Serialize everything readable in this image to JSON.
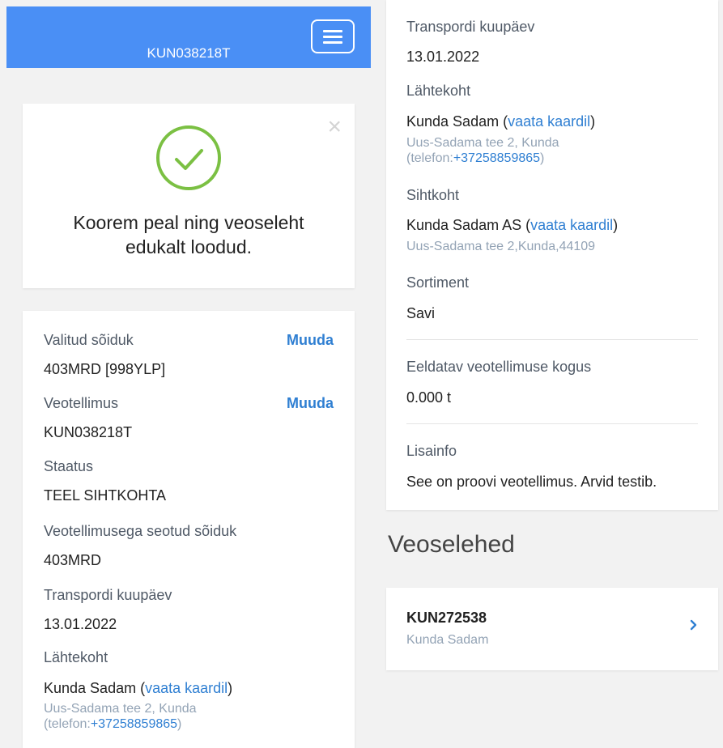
{
  "header": {
    "title": "KUN038218T"
  },
  "success": {
    "message_line1": "Koorem peal ning veoseleht",
    "message_line2": "edukalt loodud."
  },
  "details": {
    "vehicle_label": "Valitud sõiduk",
    "vehicle_value": "403MRD [998YLP]",
    "edit_label": "Muuda",
    "order_label": "Veotellimus",
    "order_value": "KUN038218T",
    "status_label": "Staatus",
    "status_value": "TEEL SIHTKOHTA",
    "linked_vehicle_label": "Veotellimusega seotud sõiduk",
    "linked_vehicle_value": "403MRD",
    "date_label": "Transpordi kuupäev",
    "date_value": "13.01.2022",
    "origin_label": "Lähtekoht",
    "origin_name": "Kunda Sadam (",
    "map_link": "vaata kaardil",
    "close_paren": ")",
    "origin_address": "Uus-Sadama tee 2, Kunda",
    "phone_prefix": "(telefon:",
    "phone": "+37258859865",
    "phone_suffix": ")"
  },
  "info": {
    "date_label": "Transpordi kuupäev",
    "date_value": "13.01.2022",
    "origin_label": "Lähtekoht",
    "origin_name": "Kunda Sadam (",
    "map_link": "vaata kaardil",
    "close_paren": ")",
    "origin_address": "Uus-Sadama tee 2, Kunda",
    "phone_prefix": "(telefon:",
    "phone": "+37258859865",
    "phone_suffix": ")",
    "dest_label": "Sihtkoht",
    "dest_name": "Kunda Sadam AS (",
    "dest_address": "Uus-Sadama tee 2,Kunda,44109",
    "assortment_label": "Sortiment",
    "assortment_value": "Savi",
    "quantity_label": "Eeldatav veotellimuse kogus",
    "quantity_value": "0.000 t",
    "extra_label": "Lisainfo",
    "extra_value": "See on proovi veotellimus. Arvid testib."
  },
  "waybills": {
    "section_title": "Veoselehed",
    "items": [
      {
        "id": "KUN272538",
        "location": "Kunda Sadam"
      }
    ]
  },
  "colors": {
    "header": "#4a8ff5",
    "accent": "#2f7fd2",
    "success": "#7bc043",
    "muted": "#93a3b5"
  },
  "icons": {
    "menu": "hamburger-icon",
    "close": "close-icon",
    "success": "check-circle-icon",
    "chevron": "chevron-right-icon"
  }
}
